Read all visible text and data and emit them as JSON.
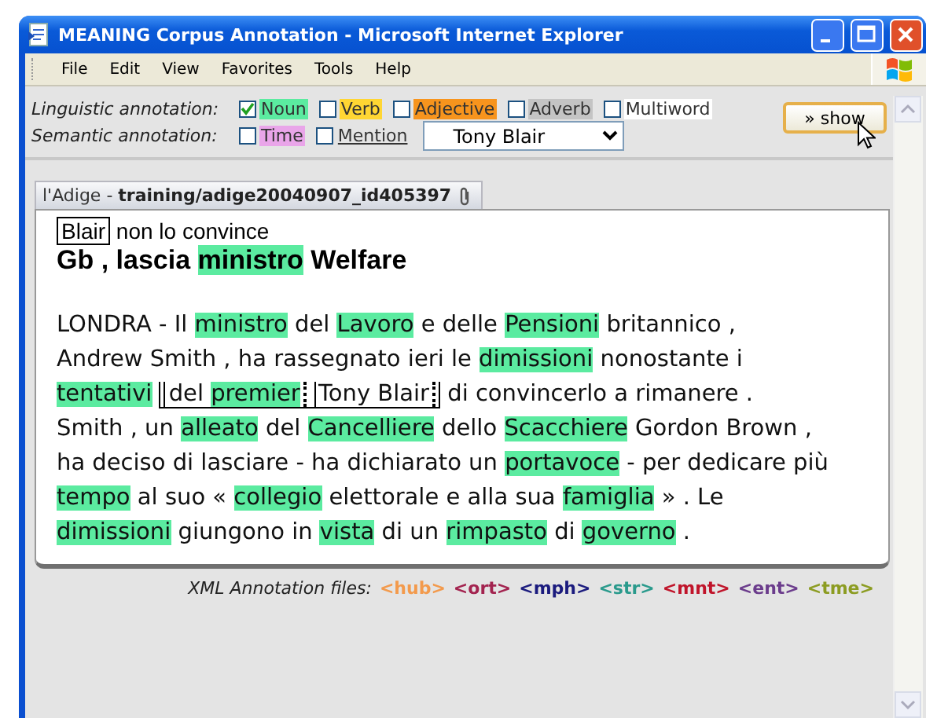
{
  "window": {
    "title": "MEANING Corpus Annotation - Microsoft Internet Explorer"
  },
  "menu": [
    "File",
    "Edit",
    "View",
    "Favorites",
    "Tools",
    "Help"
  ],
  "annotation": {
    "linguistic_label": "Linguistic annotation:",
    "linguistic": [
      {
        "label": "Noun",
        "checked": true,
        "color": "#5beba0"
      },
      {
        "label": "Verb",
        "checked": false,
        "color": "#ffd633"
      },
      {
        "label": "Adjective",
        "checked": false,
        "color": "#f7941d"
      },
      {
        "label": "Adverb",
        "checked": false,
        "color": "#c4c4c4"
      },
      {
        "label": "Multiword",
        "checked": false,
        "color": "#ffffff"
      }
    ],
    "semantic_label": "Semantic annotation:",
    "semantic": [
      {
        "label": "Time",
        "checked": false,
        "color": "#e9a5e9",
        "underlined": false
      },
      {
        "label": "Mention",
        "checked": false,
        "underlined": true
      }
    ],
    "entity_select": {
      "value": "Tony Blair"
    },
    "show_button": "» show"
  },
  "document": {
    "tab": "l'Adige - **training/adige20040907_id405397**",
    "kicker": [
      {
        "kind": "mention",
        "children": [
          {
            "kind": "text",
            "text": "Blair"
          }
        ]
      },
      {
        "kind": "text",
        "text": "non lo convince"
      }
    ],
    "headline": [
      {
        "kind": "text",
        "text": "Gb , lascia"
      },
      {
        "kind": "noun",
        "text": "ministro"
      },
      {
        "kind": "text",
        "text": "Welfare"
      }
    ],
    "body": [
      [
        {
          "kind": "text",
          "text": "LONDRA - Il"
        },
        {
          "kind": "noun",
          "text": "ministro"
        },
        {
          "kind": "text",
          "text": "del"
        },
        {
          "kind": "noun",
          "text": "Lavoro"
        },
        {
          "kind": "text",
          "text": "e delle"
        },
        {
          "kind": "noun",
          "text": "Pensioni"
        },
        {
          "kind": "text",
          "text": "britannico ,"
        }
      ],
      [
        {
          "kind": "text",
          "text": "Andrew Smith , ha rassegnato ieri le"
        },
        {
          "kind": "noun",
          "text": "dimissioni"
        },
        {
          "kind": "text",
          "text": "nonostante i"
        }
      ],
      [
        {
          "kind": "noun",
          "text": "tentativi"
        },
        {
          "kind": "mention",
          "children": [
            {
              "kind": "mention",
              "children": [
                {
                  "kind": "text",
                  "text": "del"
                },
                {
                  "kind": "noun",
                  "text": "premier"
                }
              ]
            },
            {
              "kind": "mention",
              "children": [
                {
                  "kind": "text",
                  "text": "Tony Blair"
                }
              ]
            }
          ]
        },
        {
          "kind": "text",
          "text": "di convincerlo a rimanere ."
        }
      ],
      [
        {
          "kind": "text",
          "text": "Smith , un"
        },
        {
          "kind": "noun",
          "text": "alleato"
        },
        {
          "kind": "text",
          "text": "del"
        },
        {
          "kind": "noun",
          "text": "Cancelliere"
        },
        {
          "kind": "text",
          "text": "dello"
        },
        {
          "kind": "noun",
          "text": "Scacchiere"
        },
        {
          "kind": "text",
          "text": "Gordon Brown ,"
        }
      ],
      [
        {
          "kind": "text",
          "text": "ha deciso di lasciare - ha dichiarato un"
        },
        {
          "kind": "noun",
          "text": "portavoce"
        },
        {
          "kind": "text",
          "text": "- per dedicare più"
        }
      ],
      [
        {
          "kind": "noun",
          "text": "tempo"
        },
        {
          "kind": "text",
          "text": "al suo «"
        },
        {
          "kind": "noun",
          "text": "collegio"
        },
        {
          "kind": "text",
          "text": "elettorale e alla sua"
        },
        {
          "kind": "noun",
          "text": "famiglia"
        },
        {
          "kind": "text",
          "text": "» . Le"
        }
      ],
      [
        {
          "kind": "noun",
          "text": "dimissioni"
        },
        {
          "kind": "text",
          "text": "giungono in"
        },
        {
          "kind": "noun",
          "text": "vista"
        },
        {
          "kind": "text",
          "text": "di un"
        },
        {
          "kind": "noun",
          "text": "rimpasto"
        },
        {
          "kind": "text",
          "text": "di"
        },
        {
          "kind": "noun",
          "text": "governo"
        },
        {
          "kind": "text",
          "text": "."
        }
      ]
    ]
  },
  "footer": {
    "label": "XML Annotation files:",
    "files": [
      {
        "label": "<hub>",
        "color": "#f39a4c"
      },
      {
        "label": "<ort>",
        "color": "#a3234f"
      },
      {
        "label": "<mph>",
        "color": "#1b1b7e"
      },
      {
        "label": "<str>",
        "color": "#2a9a8c"
      },
      {
        "label": "<mnt>",
        "color": "#c0142a"
      },
      {
        "label": "<ent>",
        "color": "#6b3c8c"
      },
      {
        "label": "<tme>",
        "color": "#8c9c22"
      }
    ]
  }
}
